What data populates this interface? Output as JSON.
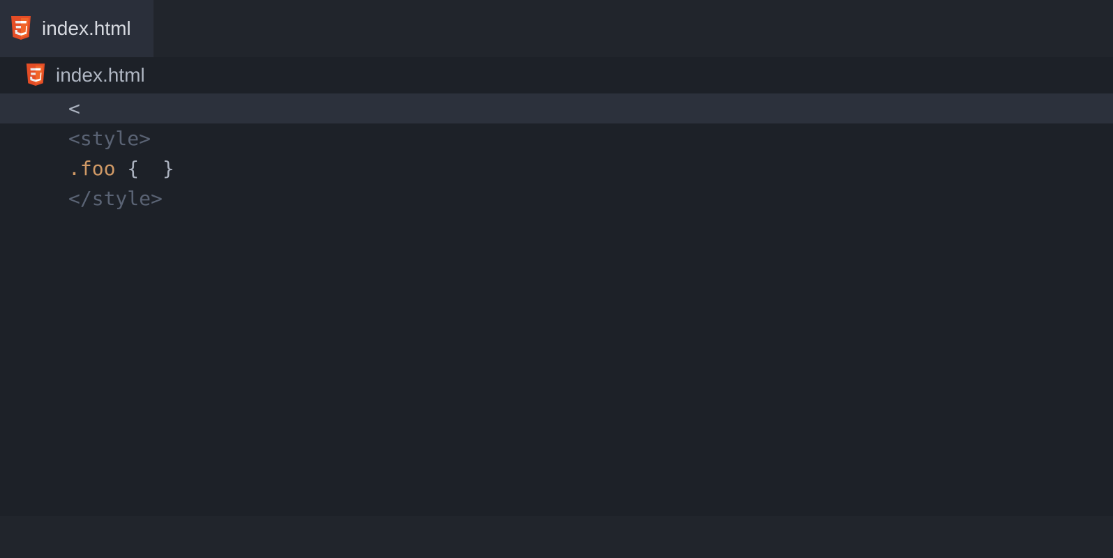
{
  "tab": {
    "title": "index.html",
    "icon": "html5-icon"
  },
  "breadcrumb": {
    "title": "index.html",
    "icon": "html5-icon"
  },
  "editor": {
    "lines": [
      {
        "current": true,
        "tokens": [
          {
            "text": "<",
            "cls": "tok-punct"
          }
        ]
      },
      {
        "current": false,
        "tokens": [
          {
            "text": "<",
            "cls": "tok-tag"
          },
          {
            "text": "style",
            "cls": "tok-tag-name"
          },
          {
            "text": ">",
            "cls": "tok-tag"
          }
        ]
      },
      {
        "current": false,
        "tokens": [
          {
            "text": ".",
            "cls": "tok-selector-dot"
          },
          {
            "text": "foo",
            "cls": "tok-selector-class"
          },
          {
            "text": " ",
            "cls": "tok-default"
          },
          {
            "text": "{",
            "cls": "tok-brace"
          },
          {
            "text": "  ",
            "cls": "tok-default"
          },
          {
            "text": "}",
            "cls": "tok-brace"
          }
        ]
      },
      {
        "current": false,
        "tokens": [
          {
            "text": "</",
            "cls": "tok-tag"
          },
          {
            "text": "style",
            "cls": "tok-tag-name"
          },
          {
            "text": ">",
            "cls": "tok-tag"
          }
        ]
      }
    ]
  }
}
